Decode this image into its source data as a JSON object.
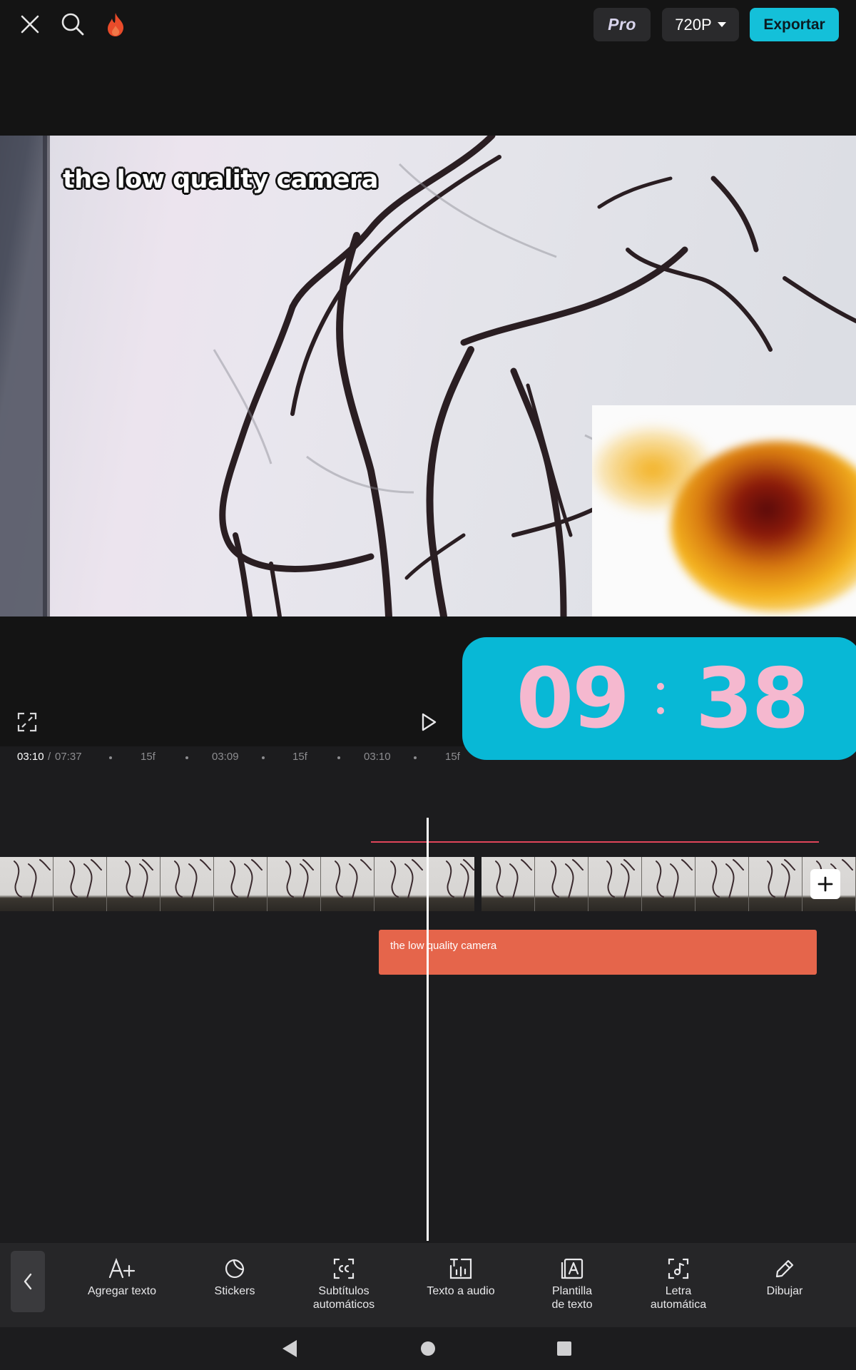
{
  "topbar": {
    "pro_label": "Pro",
    "resolution_label": "720P",
    "export_label": "Exportar"
  },
  "preview": {
    "caption": "the low quality camera"
  },
  "clock": {
    "hours": "09",
    "minutes": "38"
  },
  "ruler": {
    "current_time": "03:10",
    "separator": "/",
    "total_time": "07:37",
    "ticks": [
      "15f",
      "03:09",
      "15f",
      "03:10",
      "15f"
    ]
  },
  "timeline": {
    "text_clip_label": "the low quality camera"
  },
  "toolbar": {
    "items": [
      {
        "label": "Agregar texto",
        "icon": "add-text-icon"
      },
      {
        "label": "Stickers",
        "icon": "sticker-icon"
      },
      {
        "label": "Subtítulos\nautomáticos",
        "icon": "captions-icon"
      },
      {
        "label": "Texto a audio",
        "icon": "text-to-audio-icon"
      },
      {
        "label": "Plantilla\nde texto",
        "icon": "text-template-icon"
      },
      {
        "label": "Letra\nautomática",
        "icon": "auto-lyrics-icon"
      },
      {
        "label": "Dibujar",
        "icon": "pencil-icon"
      }
    ]
  },
  "colors": {
    "accent": "#14c0d9",
    "text_clip": "#e5654b",
    "flame": "#e94b2a",
    "clock_bg": "#08b8d6",
    "clock_digits": "#f5b8cf"
  }
}
